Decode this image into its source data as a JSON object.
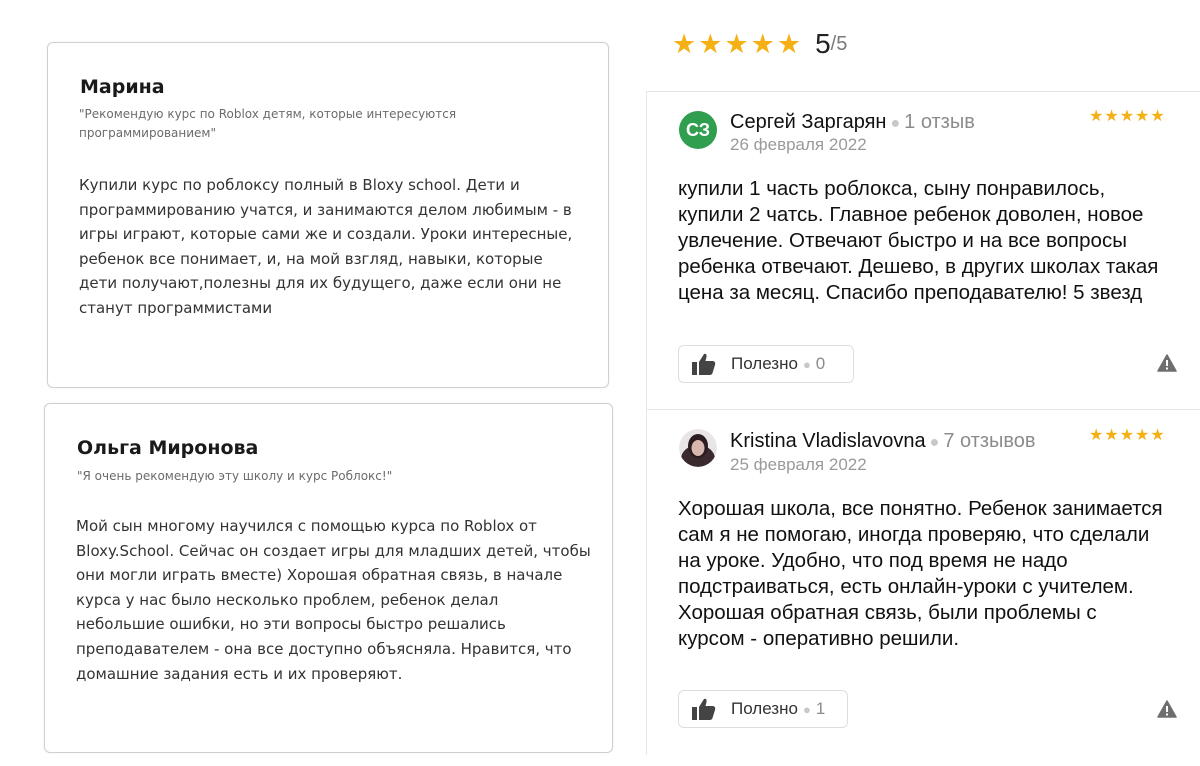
{
  "left_reviews": [
    {
      "name": "Марина",
      "quote": "\"Рекомендую курс по Roblox детям, которые интересуются программированием\"",
      "text": "Купили курс по роблоксу полный в Bloxy school. Дети и программированию учатся, и занимаются делом любимым - в игры играют, которые сами же и создали. Уроки интересные, ребенок все понимает, и, на мой взгляд, навыки, которые дети получают,полезны для их будущего, даже если они не станут программистами"
    },
    {
      "name": "Ольга Миронова",
      "quote": "\"Я очень рекомендую эту школу и курс Роблокс!\"",
      "text": "Мой сын многому научился с помощью курса по Roblox от Bloxy.School. Сейчас он создает игры для младших детей, чтобы они могли играть вместе) Хорошая обратная связь, в начале курса у нас было несколько проблем, ребенок делал небольшие ошибки, но эти вопросы быстро решались преподавателем - она все доступно объясняла. Нравится, что домашние задания есть и их проверяют."
    }
  ],
  "overall_rating": {
    "score": "5",
    "out_of": "/5",
    "stars": 5,
    "star_color": "#f5b014"
  },
  "right_reviews": [
    {
      "avatar_initials": "СЗ",
      "avatar_color": "#2f9e4f",
      "name": "Сергей Заргарян",
      "review_count": "1 отзыв",
      "date": "26 февраля 2022",
      "stars": 5,
      "text": "купили 1 часть роблокса, сыну понравилось, купили 2 чатсь. Главное ребенок доволен, новое увлечение. Отвечают быстро и на все вопросы ребенка отвечают. Дешево, в других школах такая цена за месяц. Спасибо преподавателю! 5 звезд",
      "helpful_label": "Полезно",
      "helpful_count": "0"
    },
    {
      "avatar_initials": "",
      "avatar_color": "#7a5a64",
      "name": "Kristina Vladislavovna",
      "review_count": "7 отзывов",
      "date": "25 февраля 2022",
      "stars": 5,
      "text": "Хорошая школа, все понятно. Ребенок занимается сам я не помогаю, иногда проверяю, что сделали на уроке. Удобно, что под время не надо подстраиваться, есть онлайн-уроки с учителем. Хорошая обратная связь, были проблемы с курсом - оперативно решили.",
      "helpful_label": "Полезно",
      "helpful_count": "1"
    }
  ]
}
